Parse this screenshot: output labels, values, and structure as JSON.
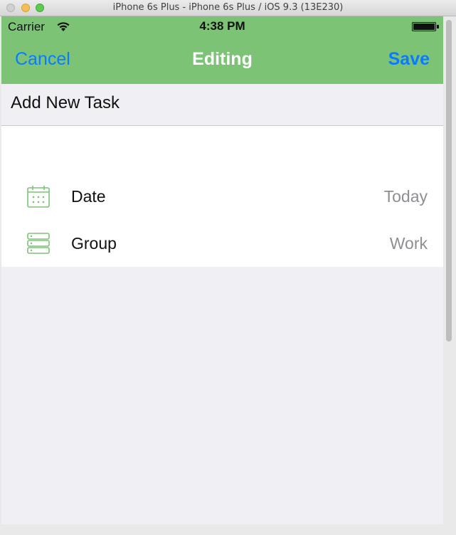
{
  "window": {
    "title": "iPhone 6s Plus - iPhone 6s Plus / iOS 9.3 (13E230)"
  },
  "status_bar": {
    "carrier": "Carrier",
    "time": "4:38 PM",
    "wifi_icon": "wifi-icon",
    "battery_icon": "battery-icon",
    "battery_level": 1.0
  },
  "navbar": {
    "cancel_label": "Cancel",
    "title": "Editing",
    "save_label": "Save",
    "background": "#7cc376",
    "tint": "#0a7bff"
  },
  "task": {
    "placeholder": "Add New Task"
  },
  "rows": [
    {
      "icon": "calendar-icon",
      "label": "Date",
      "value": "Today"
    },
    {
      "icon": "server-stack-icon",
      "label": "Group",
      "value": "Work"
    }
  ],
  "colors": {
    "accent_green": "#7cc376",
    "link_blue": "#0a7bff",
    "value_gray": "#8e8e93",
    "background": "#efeff4"
  }
}
